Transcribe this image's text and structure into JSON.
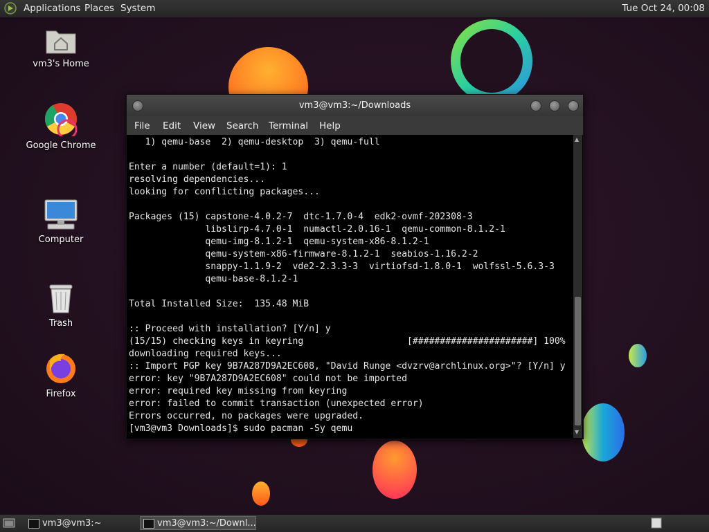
{
  "top_panel": {
    "menus": [
      "Applications",
      "Places",
      "System"
    ],
    "clock": "Tue Oct 24, 00:08"
  },
  "desktop_icons": [
    {
      "label": "vm3's Home",
      "icon": "home-folder-icon"
    },
    {
      "label": "Google Chrome",
      "icon": "chrome-icon"
    },
    {
      "label": "Computer",
      "icon": "computer-icon"
    },
    {
      "label": "Trash",
      "icon": "trash-icon"
    },
    {
      "label": "Firefox",
      "icon": "firefox-icon"
    }
  ],
  "terminal": {
    "title": "vm3@vm3:~/Downloads",
    "menu": [
      "File",
      "Edit",
      "View",
      "Search",
      "Terminal",
      "Help"
    ],
    "lines": [
      "   1) qemu-base  2) qemu-desktop  3) qemu-full",
      "",
      "Enter a number (default=1): 1",
      "resolving dependencies...",
      "looking for conflicting packages...",
      "",
      "Packages (15) capstone-4.0.2-7  dtc-1.7.0-4  edk2-ovmf-202308-3",
      "              libslirp-4.7.0-1  numactl-2.0.16-1  qemu-common-8.1.2-1",
      "              qemu-img-8.1.2-1  qemu-system-x86-8.1.2-1",
      "              qemu-system-x86-firmware-8.1.2-1  seabios-1.16.2-2",
      "              snappy-1.1.9-2  vde2-2.3.3-3  virtiofsd-1.8.0-1  wolfssl-5.6.3-3",
      "              qemu-base-8.1.2-1",
      "",
      "Total Installed Size:  135.48 MiB",
      "",
      ":: Proceed with installation? [Y/n] y",
      "(15/15) checking keys in keyring                   [######################] 100%",
      "downloading required keys...",
      ":: Import PGP key 9B7A287D9A2EC608, \"David Runge <dvzrv@archlinux.org>\"? [Y/n] y",
      "error: key \"9B7A287D9A2EC608\" could not be imported",
      "error: required key missing from keyring",
      "error: failed to commit transaction (unexpected error)",
      "Errors occurred, no packages were upgraded.",
      "[vm3@vm3 Downloads]$ sudo pacman -Sy qemu"
    ]
  },
  "taskbar": {
    "tasks": [
      {
        "label": "vm3@vm3:~",
        "active": false
      },
      {
        "label": "vm3@vm3:~/Downl...",
        "active": true
      }
    ]
  }
}
